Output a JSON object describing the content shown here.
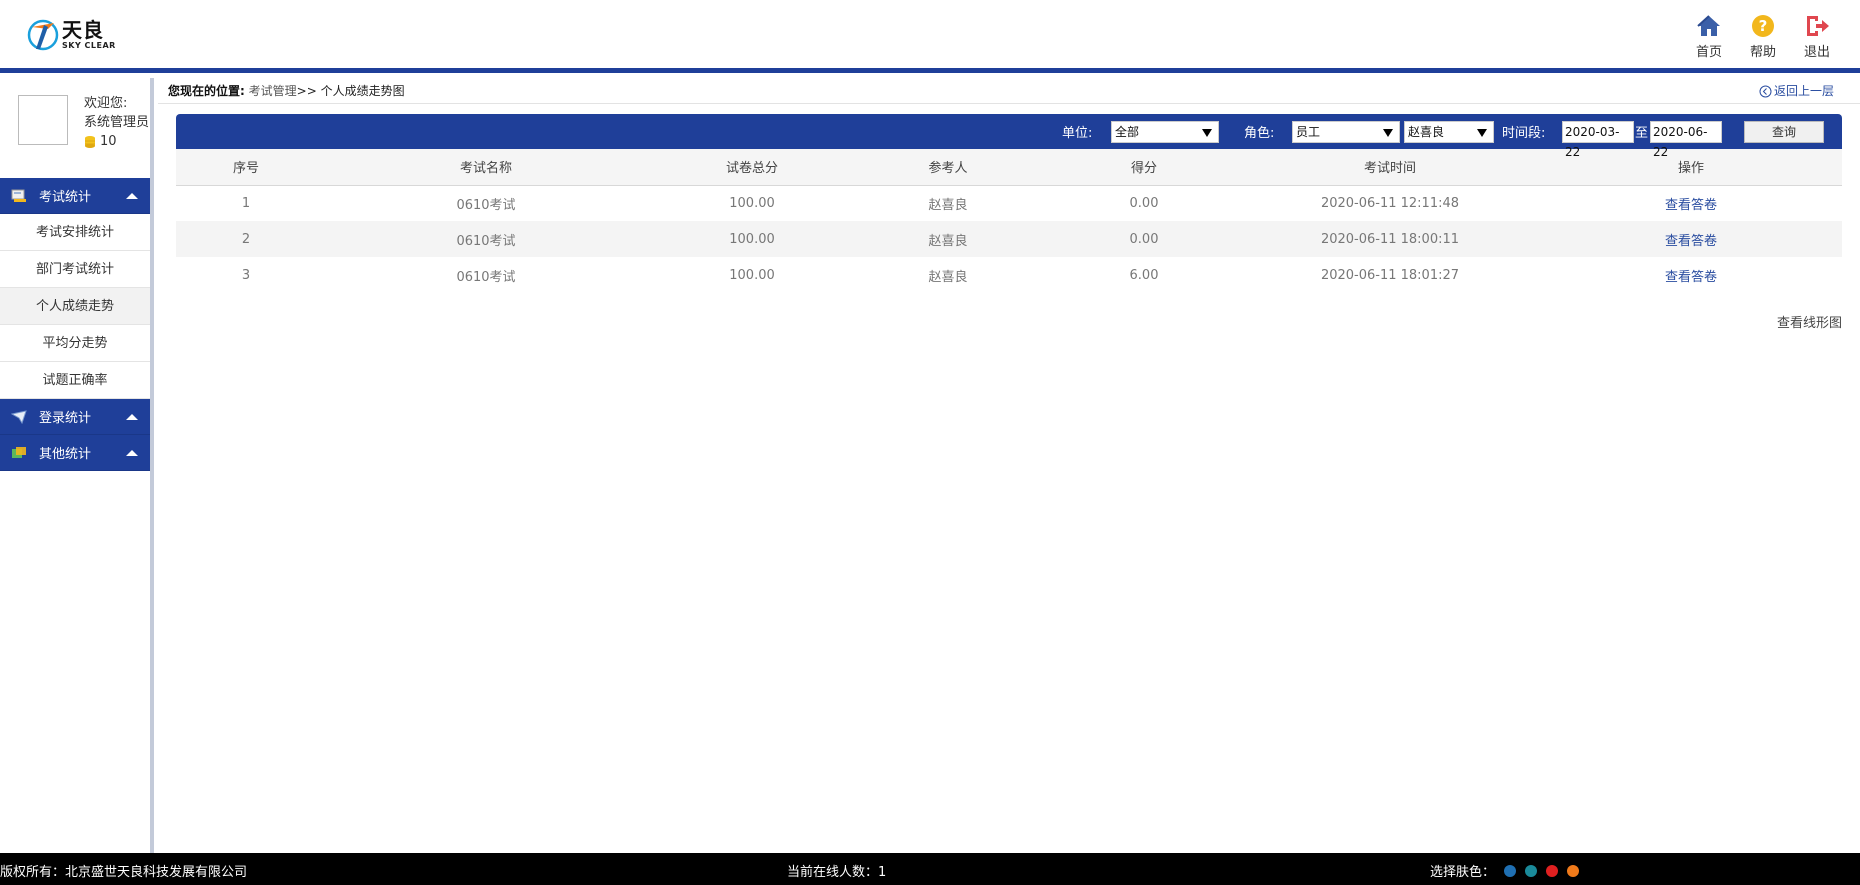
{
  "header": {
    "logo_cn": "天良",
    "logo_en": "SKY CLEAR",
    "actions": [
      {
        "label": "首页",
        "icon": "home-icon",
        "color": "#3a5fa8"
      },
      {
        "label": "帮助",
        "icon": "help-icon",
        "color": "#f2b71c"
      },
      {
        "label": "退出",
        "icon": "logout-icon",
        "color": "#e0474f"
      }
    ]
  },
  "sidebar": {
    "welcome": "欢迎您:",
    "username": "系统管理员",
    "coins": "10",
    "groups": [
      {
        "label": "考试统计",
        "icon": "exam-stats-icon",
        "items": [
          "考试安排统计",
          "部门考试统计",
          "个人成绩走势",
          "平均分走势",
          "试题正确率"
        ]
      },
      {
        "label": "登录统计",
        "icon": "login-stats-icon"
      },
      {
        "label": "其他统计",
        "icon": "other-stats-icon"
      }
    ]
  },
  "location": {
    "label": "您现在的位置:",
    "crumb": "考试管理",
    "sep": ">>",
    "current": "个人成绩走势图",
    "back": "返回上一层"
  },
  "filters": {
    "unit_label": "单位:",
    "unit_value": "全部",
    "role_label": "角色:",
    "role_value": "员工",
    "person_value": "赵喜良",
    "period_label": "时间段:",
    "date_from": "2020-03-22",
    "to_label": "至",
    "date_to": "2020-06-22",
    "query_button": "查询"
  },
  "table": {
    "columns": [
      "序号",
      "考试名称",
      "试卷总分",
      "参考人",
      "得分",
      "考试时间",
      "操作"
    ],
    "rows": [
      {
        "no": "1",
        "name": "0610考试",
        "total": "100.00",
        "person": "赵喜良",
        "score": "0.00",
        "time": "2020-06-11 12:11:48",
        "op": "查看答卷"
      },
      {
        "no": "2",
        "name": "0610考试",
        "total": "100.00",
        "person": "赵喜良",
        "score": "0.00",
        "time": "2020-06-11 18:00:11",
        "op": "查看答卷"
      },
      {
        "no": "3",
        "name": "0610考试",
        "total": "100.00",
        "person": "赵喜良",
        "score": "6.00",
        "time": "2020-06-11 18:01:27",
        "op": "查看答卷"
      }
    ],
    "chart_link": "查看线形图"
  },
  "footer": {
    "copyright": "版权所有：北京盛世天良科技发展有限公司",
    "online": "当前在线人数：1",
    "skin_label": "选择肤色：",
    "skins": [
      "#1f6fb2",
      "#1a8a9a",
      "#e02020",
      "#f07a1a"
    ]
  }
}
